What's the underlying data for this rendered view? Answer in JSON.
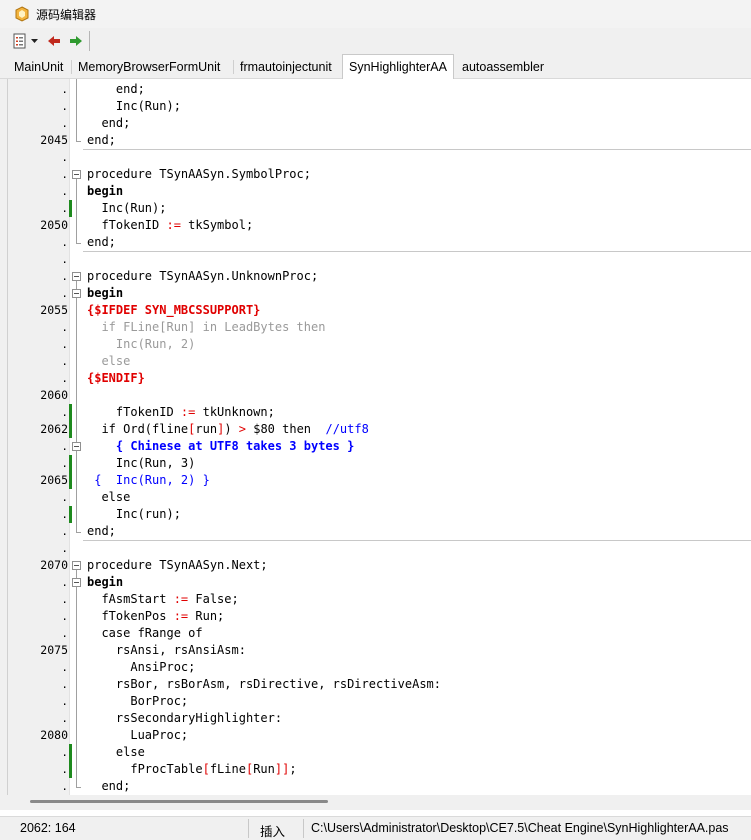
{
  "window": {
    "title": "源码编辑器"
  },
  "toolbar": {
    "icons": [
      "list-icon",
      "dropdown-arrow-icon",
      "back-arrow-icon",
      "forward-arrow-icon"
    ]
  },
  "tabs": [
    {
      "label": "MainUnit",
      "active": false
    },
    {
      "label": "MemoryBrowserFormUnit",
      "active": false
    },
    {
      "label": "frmautoinjectunit",
      "active": false
    },
    {
      "label": "SynHighlighterAA",
      "active": true
    },
    {
      "label": "autoassembler",
      "active": false
    }
  ],
  "editor": {
    "gutter": [
      ".",
      ".",
      ".",
      "2045",
      ".",
      ".",
      ".",
      ".",
      "2050",
      ".",
      ".",
      ".",
      ".",
      "2055",
      ".",
      ".",
      ".",
      ".",
      "2060",
      ".",
      "2062",
      ".",
      ".",
      "2065",
      ".",
      ".",
      ".",
      ".",
      "2070",
      ".",
      ".",
      ".",
      ".",
      "2075",
      ".",
      ".",
      ".",
      ".",
      "2080",
      ".",
      ".",
      "."
    ],
    "lines": [
      [
        [
          "    end;",
          "p"
        ]
      ],
      [
        [
          "    Inc(Run);",
          "p"
        ]
      ],
      [
        [
          "  end;",
          "p"
        ]
      ],
      [
        [
          "end;",
          "p"
        ]
      ],
      [],
      [
        [
          "procedure TSynAASyn.SymbolProc;",
          "p"
        ]
      ],
      [
        [
          "begin",
          "kw"
        ]
      ],
      [
        [
          "  Inc(Run);",
          "p"
        ]
      ],
      [
        [
          "  fTokenID ",
          "p"
        ],
        [
          ":=",
          "sym"
        ],
        [
          " tkSymbol;",
          "p"
        ]
      ],
      [
        [
          "end;",
          "p"
        ]
      ],
      [],
      [
        [
          "procedure TSynAASyn.UnknownProc;",
          "p"
        ]
      ],
      [
        [
          "begin",
          "kw"
        ]
      ],
      [
        [
          "{$IFDEF SYN_MBCSSUPPORT}",
          "dir"
        ]
      ],
      [
        [
          "  if FLine[Run] in LeadBytes then",
          "inact"
        ]
      ],
      [
        [
          "    Inc(Run, 2)",
          "inact"
        ]
      ],
      [
        [
          "  else",
          "inact"
        ]
      ],
      [
        [
          "{$ENDIF}",
          "dir"
        ]
      ],
      [],
      [
        [
          "    fTokenID ",
          "p"
        ],
        [
          ":=",
          "sym"
        ],
        [
          " tkUnknown;",
          "p"
        ]
      ],
      [
        [
          "  if Ord(fline",
          "p"
        ],
        [
          "[",
          "sym"
        ],
        [
          "run",
          "p"
        ],
        [
          "]",
          "sym"
        ],
        [
          ") ",
          "p"
        ],
        [
          ">",
          "sym"
        ],
        [
          " $80 then  ",
          "p"
        ],
        [
          "//utf8",
          "cm"
        ]
      ],
      [
        [
          "    { Chinese at UTF8 takes 3 bytes }",
          "cmb"
        ]
      ],
      [
        [
          "    Inc(Run, 3)",
          "p"
        ]
      ],
      [
        [
          " {  Inc(Run, 2) }",
          "cm"
        ]
      ],
      [
        [
          "  else",
          "p"
        ]
      ],
      [
        [
          "    Inc(run);",
          "p"
        ]
      ],
      [
        [
          "end;",
          "p"
        ]
      ],
      [],
      [
        [
          "procedure TSynAASyn.Next;",
          "p"
        ]
      ],
      [
        [
          "begin",
          "kw"
        ]
      ],
      [
        [
          "  fAsmStart ",
          "p"
        ],
        [
          ":=",
          "sym"
        ],
        [
          " False;",
          "p"
        ]
      ],
      [
        [
          "  fTokenPos ",
          "p"
        ],
        [
          ":=",
          "sym"
        ],
        [
          " Run;",
          "p"
        ]
      ],
      [
        [
          "  case fRange of",
          "p"
        ]
      ],
      [
        [
          "    rsAnsi, rsAnsiAsm:",
          "p"
        ]
      ],
      [
        [
          "      AnsiProc;",
          "p"
        ]
      ],
      [
        [
          "    rsBor, rsBorAsm, rsDirective, rsDirectiveAsm:",
          "p"
        ]
      ],
      [
        [
          "      BorProc;",
          "p"
        ]
      ],
      [
        [
          "    rsSecondaryHighlighter:",
          "p"
        ]
      ],
      [
        [
          "      LuaProc;",
          "p"
        ]
      ],
      [
        [
          "    else",
          "p"
        ]
      ],
      [
        [
          "      fProcTable",
          "p"
        ],
        [
          "[",
          "sym"
        ],
        [
          "fLine",
          "p"
        ],
        [
          "[",
          "sym"
        ],
        [
          "Run",
          "p"
        ],
        [
          "]]",
          "sym"
        ],
        [
          ";",
          "p"
        ]
      ],
      [
        [
          "  end;",
          "p"
        ]
      ]
    ]
  },
  "status": {
    "position": "2062: 164",
    "mode": "插入",
    "path": "C:\\Users\\Administrator\\Desktop\\CE7.5\\Cheat Engine\\SynHighlighterAA.pas"
  }
}
